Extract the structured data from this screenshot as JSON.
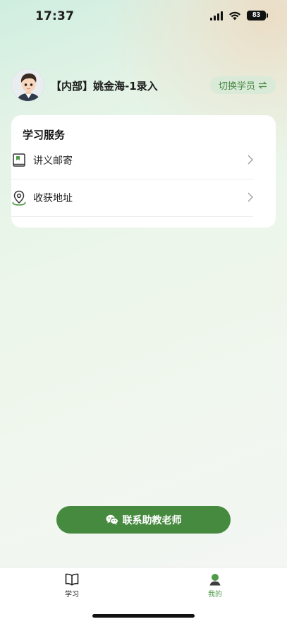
{
  "status_bar": {
    "time": "17:37",
    "battery": "83"
  },
  "profile": {
    "name": "【内部】姚金海-1录入",
    "switch_label": "切换学员"
  },
  "services": {
    "title": "学习服务",
    "items": [
      {
        "label": "讲义邮寄",
        "icon": "book-icon"
      },
      {
        "label": "收获地址",
        "icon": "location-pin-icon"
      }
    ]
  },
  "contact_button": {
    "label": "联系助教老师",
    "icon": "wechat-icon"
  },
  "tabbar": {
    "tabs": [
      {
        "label": "学习",
        "icon": "open-book-icon",
        "active": false
      },
      {
        "label": "我的",
        "icon": "person-icon",
        "active": true
      }
    ]
  },
  "colors": {
    "accent": "#468a3f",
    "accent_light": "#d9ead8",
    "active_tab": "#4e9a48"
  }
}
